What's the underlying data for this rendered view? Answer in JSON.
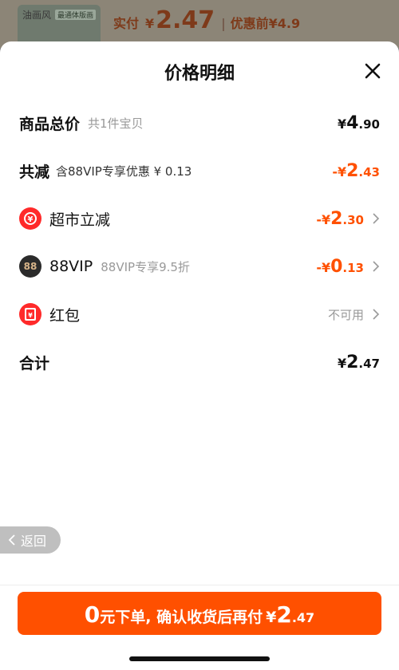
{
  "background": {
    "thumb_text": "油画风",
    "thumb_tag": "最通体版画",
    "paid_label": "实付",
    "paid_symbol": "¥",
    "paid_amount": "2.47",
    "before_label": "优惠前",
    "before_amount": "¥4.9"
  },
  "sheet": {
    "title": "价格明细",
    "rows": {
      "total": {
        "label": "商品总价",
        "sub": "共1件宝贝",
        "symbol": "¥",
        "int": "4",
        "dec": ".90"
      },
      "reduction": {
        "label": "共减",
        "sub": "含88VIP专享优惠 ¥ 0.13",
        "symbol": "-¥",
        "int": "2",
        "dec": ".43"
      },
      "supermarket": {
        "label": "超市立减",
        "symbol": "-¥",
        "int": "2",
        "dec": ".30",
        "icon": "yen-coin-icon"
      },
      "vip": {
        "badge": "88",
        "label": "88VIP",
        "sub": "88VIP专享9.5折",
        "symbol": "-¥",
        "int": "0",
        "dec": ".13",
        "icon": "88vip-badge-icon"
      },
      "redpacket": {
        "label": "红包",
        "status": "不可用",
        "icon": "red-packet-icon"
      },
      "sum": {
        "label": "合计",
        "symbol": "¥",
        "int": "2",
        "dec": ".47"
      }
    }
  },
  "back": {
    "label": "返回"
  },
  "cta": {
    "zero": "0",
    "text": "元下单, 确认收货后再付",
    "symbol": "¥",
    "int": "2",
    "dec": ".47"
  },
  "colors": {
    "accent": "#ff5000",
    "red_icon": "#ff2a2a"
  }
}
